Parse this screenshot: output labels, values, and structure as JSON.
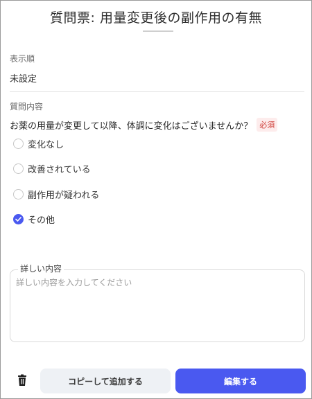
{
  "header": {
    "title": "質問票: 用量変更後の副作用の有無"
  },
  "display_order": {
    "label": "表示順",
    "value": "未設定"
  },
  "question": {
    "section_label": "質問内容",
    "text": "お薬の用量が変更して以降、体調に変化はございませんか？",
    "required_badge": "必須",
    "options": [
      {
        "label": "変化なし",
        "checked": false
      },
      {
        "label": "改善されている",
        "checked": false
      },
      {
        "label": "副作用が疑われる",
        "checked": false
      },
      {
        "label": "その他",
        "checked": true
      }
    ]
  },
  "details": {
    "legend": "詳しい内容",
    "placeholder": "詳しい内容を入力してください",
    "value": ""
  },
  "actions": {
    "delete_icon": "trash-icon",
    "copy_label": "コピーして追加する",
    "edit_label": "編集する"
  },
  "colors": {
    "accent": "#4a59f0",
    "required": "#d0443f",
    "required_bg": "#fdecec"
  }
}
